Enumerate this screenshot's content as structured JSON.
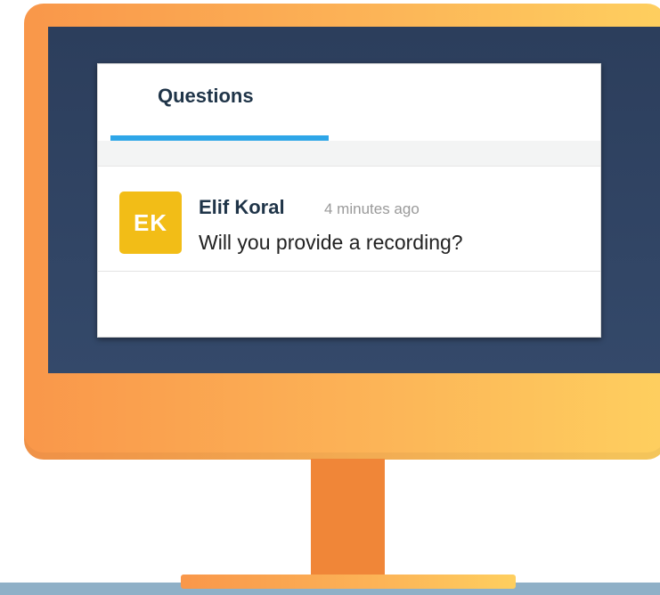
{
  "tabs": [
    {
      "label": "Questions",
      "active": true
    }
  ],
  "questions": [
    {
      "avatar_initials": "EK",
      "avatar_color": "#f2bd17",
      "author": "Elif Koral",
      "time": "4 minutes ago",
      "text": "Will you provide a recording?"
    }
  ],
  "colors": {
    "monitor": "#fcb457",
    "screen_bezel": "#2c3e5c",
    "stand": "#f08638",
    "tab_accent": "#2ea6e8",
    "title_text": "#1f3448"
  }
}
